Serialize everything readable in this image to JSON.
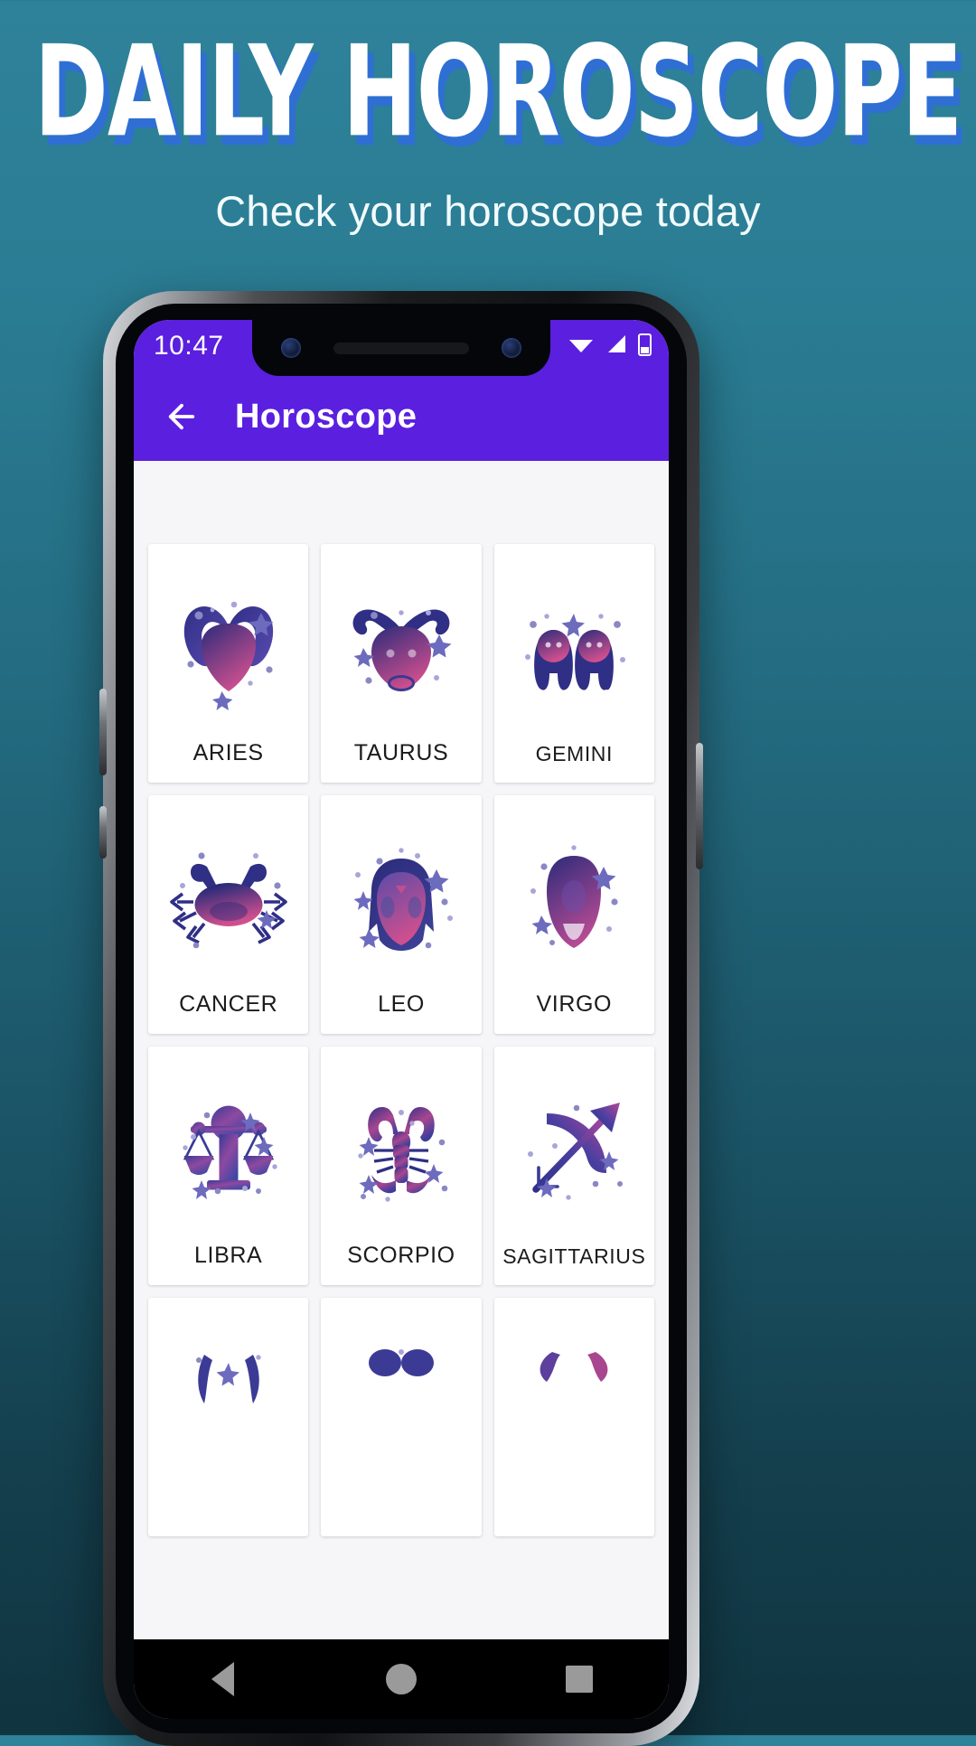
{
  "promo": {
    "title": "DAILY HOROSCOPE",
    "subtitle": "Check your horoscope today",
    "title_shadow_color": "#2f6fd4",
    "bg_top_color": "#2e8299",
    "bg_bottom_color": "#103440"
  },
  "phone": {
    "status_bar": {
      "time": "10:47",
      "bg_color": "#5b1fe0",
      "icons": [
        "wifi-icon",
        "signal-icon",
        "battery-icon"
      ]
    },
    "app_bar": {
      "back_icon": "arrow-left-icon",
      "title": "Horoscope",
      "bg_color": "#5b1fe0"
    },
    "nav_bar": {
      "back_label": "Back",
      "home_label": "Home",
      "recents_label": "Recents"
    }
  },
  "screen": {
    "accent_color": "#5b1fe0",
    "card_bg_color": "#ffffff",
    "content_bg_color": "#f6f6f8",
    "icon_gradient_from": "#2b2b7a",
    "icon_gradient_to": "#d0508f",
    "zodiac_cards": [
      {
        "label": "ARIES",
        "icon": "aries-ram-icon"
      },
      {
        "label": "TAURUS",
        "icon": "taurus-bull-icon"
      },
      {
        "label": "GEMINI",
        "icon": "gemini-twins-icon"
      },
      {
        "label": "CANCER",
        "icon": "cancer-crab-icon"
      },
      {
        "label": "LEO",
        "icon": "leo-lion-icon"
      },
      {
        "label": "VIRGO",
        "icon": "virgo-maiden-icon"
      },
      {
        "label": "LIBRA",
        "icon": "libra-scales-icon"
      },
      {
        "label": "SCORPIO",
        "icon": "scorpio-scorpion-icon"
      },
      {
        "label": "SAGITTARIUS",
        "icon": "sagittarius-bow-icon"
      },
      {
        "label": "",
        "icon": "capricorn-goat-icon"
      },
      {
        "label": "",
        "icon": "aquarius-water-bearer-icon"
      },
      {
        "label": "",
        "icon": "pisces-fish-icon"
      }
    ]
  }
}
